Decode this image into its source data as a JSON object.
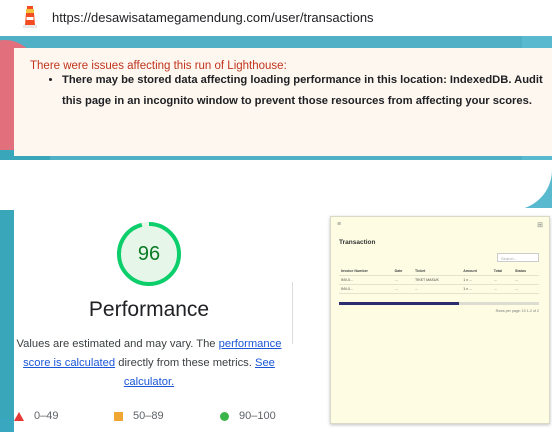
{
  "topbar": {
    "url": "https://desawisatamegamendung.com/user/transactions",
    "logo_icon": "lighthouse-icon"
  },
  "warning": {
    "title": "There were issues affecting this run of Lighthouse:",
    "items": [
      "There may be stored data affecting loading performance in this location: IndexedDB. Audit this page in an incognito window to prevent those resources from affecting your scores."
    ]
  },
  "performance": {
    "score": "96",
    "score_fraction": 0.96,
    "score_color": "#0cce6b",
    "title": "Performance",
    "desc_prefix": "Values are estimated and may vary. The ",
    "desc_link1": "performance score is calculated",
    "desc_middle": " directly from these metrics. ",
    "desc_link2": "See calculator."
  },
  "legend": [
    {
      "icon": "triangle-fail-icon",
      "label": "0–49",
      "color": "#e53935"
    },
    {
      "icon": "square-average-icon",
      "label": "50–89",
      "color": "#f0a632"
    },
    {
      "icon": "circle-pass-icon",
      "label": "90–100",
      "color": "#3bb54a"
    }
  ],
  "thumbnail": {
    "heading": "Transaction",
    "search_placeholder": "Search...",
    "columns": [
      "Invoice Number",
      "Date",
      "Ticket",
      "Amount",
      "Total",
      "Status"
    ],
    "rows": [
      [
        "INV-0...",
        "...",
        "TIKET MASUK",
        "1 x ...",
        "...",
        "..."
      ],
      [
        "INV-0...",
        "...",
        "...",
        "1 x ...",
        "...",
        "..."
      ]
    ],
    "pager": "Rows per page: 10  1-2 of 2"
  }
}
